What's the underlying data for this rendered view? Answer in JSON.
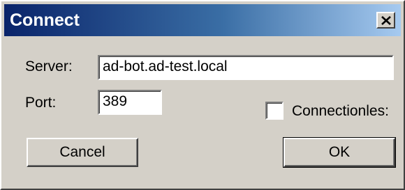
{
  "window": {
    "title": "Connect",
    "close_label": "×"
  },
  "form": {
    "server_label": "Server:",
    "server_value": "ad-bot.ad-test.local",
    "port_label": "Port:",
    "port_value": "389",
    "connectionless_label": "Connectionles:",
    "connectionless_checked": false
  },
  "buttons": {
    "cancel_label": "Cancel",
    "ok_label": "OK"
  },
  "colors": {
    "titlebar_start": "#0a246a",
    "titlebar_end": "#a6caf0",
    "dialog_face": "#d4d0c8"
  },
  "icons": {
    "close": "close-icon"
  }
}
